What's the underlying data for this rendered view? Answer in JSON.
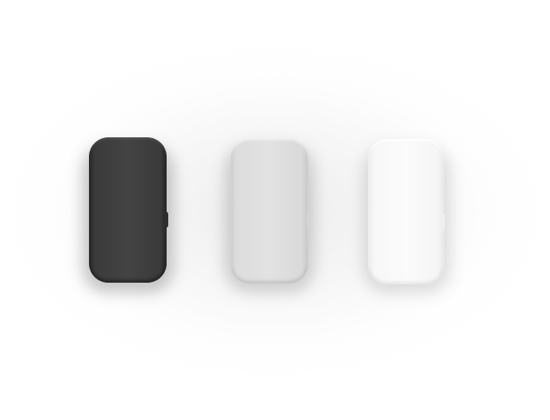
{
  "scene": {
    "background_color": "#ffffff",
    "devices": [
      {
        "color_name": "dark",
        "body_color": "#434343"
      },
      {
        "color_name": "gray",
        "body_color": "#e2e2e2"
      },
      {
        "color_name": "white",
        "body_color": "#fbfbfb"
      }
    ]
  }
}
